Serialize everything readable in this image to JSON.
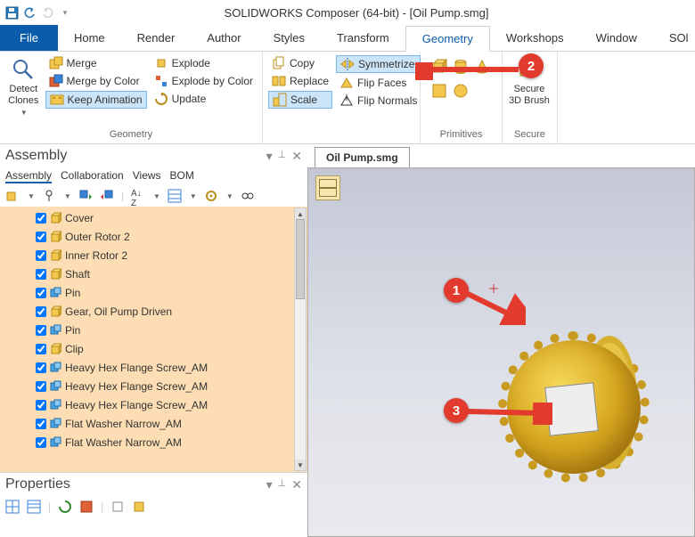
{
  "app": {
    "title": "SOLIDWORKS Composer (64-bit) - [Oil Pump.smg]"
  },
  "tabs": {
    "file": "File",
    "home": "Home",
    "render": "Render",
    "author": "Author",
    "styles": "Styles",
    "transform": "Transform",
    "geometry": "Geometry",
    "workshops": "Workshops",
    "window": "Window",
    "sol": "SOl"
  },
  "ribbon": {
    "detect_clones": "Detect Clones",
    "merge": "Merge",
    "merge_by_color": "Merge by Color",
    "keep_animation": "Keep Animation",
    "explode": "Explode",
    "explode_by_color": "Explode by Color",
    "update": "Update",
    "geometry_group": "Geometry",
    "copy": "Copy",
    "replace": "Replace",
    "scale": "Scale",
    "symmetrize": "Symmetrize",
    "flip_faces": "Flip Faces",
    "flip_normals": "Flip Normals",
    "primitives_group": "Primitives",
    "secure": "Secure 3D Brush",
    "secure_group": "Secure"
  },
  "assembly": {
    "title": "Assembly",
    "subtabs": {
      "assembly": "Assembly",
      "collaboration": "Collaboration",
      "views": "Views",
      "bom": "BOM"
    },
    "items": [
      {
        "label": "Cover",
        "type": "part"
      },
      {
        "label": "Outer Rotor 2",
        "type": "part"
      },
      {
        "label": "Inner Rotor 2",
        "type": "part"
      },
      {
        "label": "Shaft",
        "type": "part"
      },
      {
        "label": "Pin",
        "type": "asm"
      },
      {
        "label": "Gear, Oil Pump Driven",
        "type": "part"
      },
      {
        "label": "Pin",
        "type": "asm"
      },
      {
        "label": "Clip",
        "type": "part"
      },
      {
        "label": "Heavy Hex Flange Screw_AM",
        "type": "asm"
      },
      {
        "label": "Heavy Hex Flange Screw_AM",
        "type": "asm"
      },
      {
        "label": "Heavy Hex Flange Screw_AM",
        "type": "asm"
      },
      {
        "label": "Flat Washer Narrow_AM",
        "type": "asm"
      },
      {
        "label": "Flat Washer Narrow_AM",
        "type": "asm"
      }
    ]
  },
  "properties": {
    "title": "Properties"
  },
  "doc": {
    "tab": "Oil Pump.smg"
  },
  "callouts": {
    "c1": "1",
    "c2": "2",
    "c3": "3"
  }
}
